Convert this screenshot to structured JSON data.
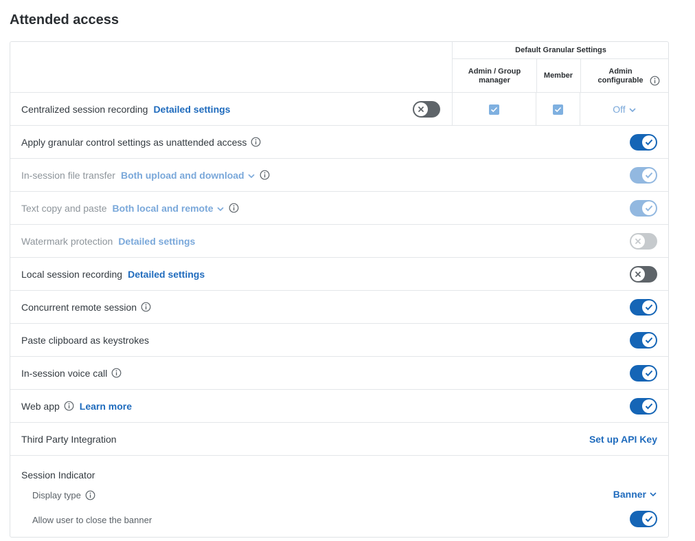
{
  "page_title": "Attended access",
  "granular": {
    "title": "Default Granular Settings",
    "col_admin": "Admin / Group manager",
    "col_member": "Member",
    "col_configurable": "Admin configurable",
    "configurable_value": "Off"
  },
  "rows": [
    {
      "label": "Centralized session recording",
      "link": "Detailed settings",
      "toggle": "off"
    },
    {
      "label": "Apply granular control settings as unattended access",
      "toggle": "on"
    },
    {
      "label": "In-session file transfer",
      "dropdown": "Both upload and download",
      "toggle": "on-disabled"
    },
    {
      "label": "Text copy and paste",
      "dropdown": "Both local and remote",
      "toggle": "on-disabled"
    },
    {
      "label": "Watermark protection",
      "link": "Detailed settings",
      "toggle": "off-disabled"
    },
    {
      "label": "Local session recording",
      "link": "Detailed settings",
      "toggle": "off"
    },
    {
      "label": "Concurrent remote session",
      "toggle": "on"
    },
    {
      "label": "Paste clipboard as keystrokes",
      "toggle": "on"
    },
    {
      "label": "In-session voice call",
      "toggle": "on"
    },
    {
      "label": "Web app",
      "link": "Learn more",
      "toggle": "on"
    },
    {
      "label": "Third Party Integration",
      "action": "Set up API Key"
    }
  ],
  "session_indicator": {
    "title": "Session Indicator",
    "display_type_label": "Display type",
    "display_type_value": "Banner",
    "close_banner_label": "Allow user to close the banner",
    "close_banner_toggle": "on"
  },
  "colors": {
    "accent": "#1565b6",
    "link": "#1f6bbd",
    "toggle_off": "#5e6469",
    "disabled_link": "#7aa8da"
  }
}
